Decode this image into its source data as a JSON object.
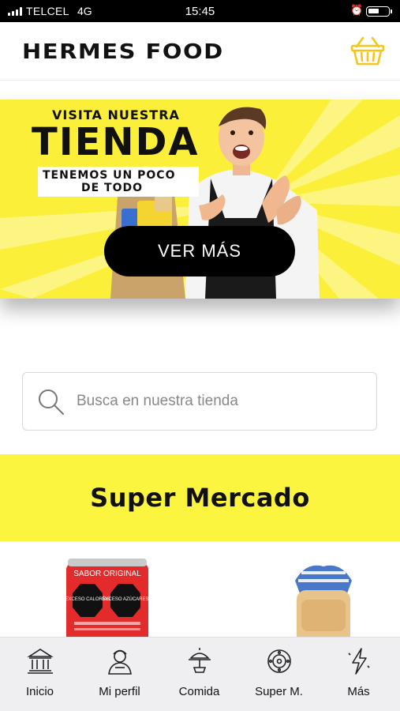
{
  "status_bar": {
    "carrier": "TELCEL",
    "network": "4G",
    "time": "15:45",
    "battery_level": 0.55
  },
  "header": {
    "logo": "HERMES FOOD",
    "cart_icon": "basket-icon",
    "accent": "#f5c518"
  },
  "banner": {
    "line1": "VISITA NUESTRA",
    "line2": "TIENDA",
    "line3": "TENEMOS UN POCO",
    "line4": "DE TODO",
    "cta_label": "VER MÁS",
    "background": "#fbef3a"
  },
  "search": {
    "placeholder": "Busca en nuestra tienda",
    "icon": "search-icon"
  },
  "section": {
    "title": "Super Mercado",
    "background": "#fbf540"
  },
  "products": {
    "can_label": "SABOR ORIGINAL",
    "can_warning_1": "EXCESO CALORÍAS",
    "can_warning_2": "EXCESO AZÚCARES"
  },
  "nav": {
    "items": [
      {
        "label": "Inicio",
        "icon": "bank-icon"
      },
      {
        "label": "Mi perfil",
        "icon": "profile-icon"
      },
      {
        "label": "Comida",
        "icon": "food-icon"
      },
      {
        "label": "Super M.",
        "icon": "market-icon"
      },
      {
        "label": "Más",
        "icon": "bolt-icon"
      }
    ]
  }
}
